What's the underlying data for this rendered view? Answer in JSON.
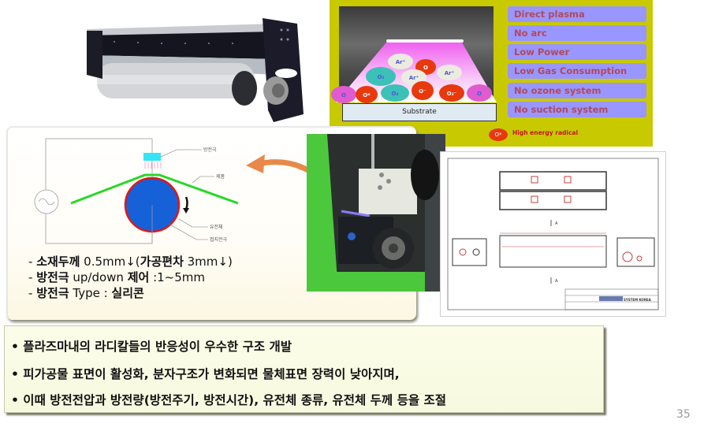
{
  "slide": {
    "page_number": "35"
  },
  "plasma_panel": {
    "features": [
      "Direct plasma",
      "No arc",
      "Low Power",
      "Low Gas Consumption",
      "No ozone system",
      "No suction system"
    ],
    "substrate_label": "Substrate",
    "particles": [
      "Ar⁺",
      "O",
      "Ar⁺",
      "Ar⁺",
      "O₂",
      "O",
      "O*",
      "O₂",
      "O⁻",
      "O₂⁻",
      "O"
    ],
    "legend": {
      "symbol": "O*",
      "label": "High energy radical"
    },
    "colors": {
      "background": "#c9c900",
      "feature_box": "#9a96ff",
      "feature_text": "#b04a5a",
      "radical": "#e8380c",
      "ar_ion": "#ecebe0",
      "o2": "#3cc0b8",
      "o_minus": "#e05ad0"
    }
  },
  "schematic": {
    "labels": {
      "discharge_electrode": "방전극",
      "product": "제품",
      "dielectric": "유전체",
      "ground_electrode": "접지전극"
    }
  },
  "specs": [
    {
      "prefix": "- ",
      "bold1": "소재두께",
      "text1": " 0.5mm↓(",
      "bold2": "가공편차",
      "text2": " 3mm↓)"
    },
    {
      "prefix": "- ",
      "bold1": "방전극",
      "text1": " up/down ",
      "bold2": "제어",
      "text2": " :1~5mm"
    },
    {
      "prefix": "- ",
      "bold1": "방전극",
      "text1": " Type : ",
      "bold2": "실리콘",
      "text2": ""
    }
  ],
  "bottom_box": {
    "lines": [
      "• 플라즈마내의 라디칼들의 반응성이 우수한 구조 개발",
      "• 피가공물 표면이 활성화, 분자구조가 변화되면 물체표면 장력이 낮아지며,",
      "•  이때 방전전압과 방전량(방전주기, 방전시간), 유전체 종류, 유전체 두께 등을 조절"
    ]
  },
  "drawing": {
    "section_marks": [
      "A",
      "A"
    ],
    "title_block_brand": "SYSTEM KOREA"
  }
}
